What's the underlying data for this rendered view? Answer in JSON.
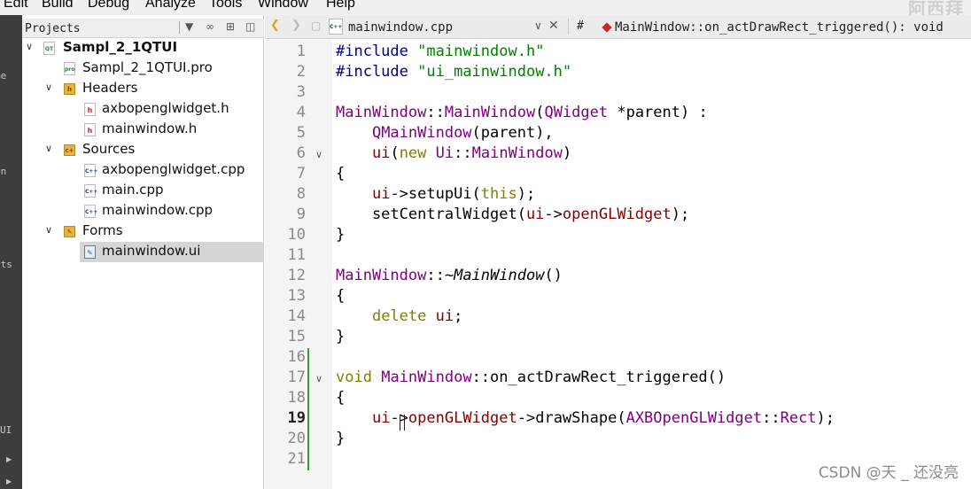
{
  "menu": [
    "Edit",
    "Build",
    "Debug",
    "Analyze",
    "Tools",
    "Window",
    "Help"
  ],
  "top_watermark": "阿西拜",
  "mode_bar": [
    "me",
    "t",
    "gn",
    "g",
    "cts",
    "p",
    "UI"
  ],
  "projects_panel": {
    "title": "Projects",
    "tree": [
      {
        "label": "Sampl_2_1QTUI",
        "icon": "project-icon",
        "expanded": true,
        "bold": true
      },
      {
        "label": "Sampl_2_1QTUI.pro",
        "icon": "pro-file-icon"
      },
      {
        "label": "Headers",
        "icon": "folder-icon",
        "expanded": true
      },
      {
        "label": "axbopenglwidget.h",
        "icon": "header-file-icon"
      },
      {
        "label": "mainwindow.h",
        "icon": "header-file-icon"
      },
      {
        "label": "Sources",
        "icon": "folder-icon",
        "expanded": true
      },
      {
        "label": "axbopenglwidget.cpp",
        "icon": "cpp-file-icon"
      },
      {
        "label": "main.cpp",
        "icon": "cpp-file-icon"
      },
      {
        "label": "mainwindow.cpp",
        "icon": "cpp-file-icon"
      },
      {
        "label": "Forms",
        "icon": "folder-icon",
        "expanded": true
      },
      {
        "label": "mainwindow.ui",
        "icon": "ui-file-icon",
        "selected": true
      }
    ]
  },
  "editor": {
    "open_file": "mainwindow.cpp",
    "hash": "#",
    "current_symbol": "MainWindow::on_actDrawRect_triggered(): void",
    "current_line": 19,
    "line_numbers": [
      "1",
      "2",
      "3",
      "4",
      "5",
      "6",
      "7",
      "8",
      "9",
      "10",
      "11",
      "12",
      "13",
      "14",
      "15",
      "16",
      "17",
      "18",
      "19",
      "20",
      "21"
    ],
    "lines": [
      "#include \"mainwindow.h\"",
      "#include \"ui_mainwindow.h\"",
      "",
      "MainWindow::MainWindow(QWidget *parent) :",
      "    QMainWindow(parent),",
      "    ui(new Ui::MainWindow)",
      "{",
      "    ui->setupUi(this);",
      "    setCentralWidget(ui->openGLWidget);",
      "}",
      "",
      "MainWindow::~MainWindow()",
      "{",
      "    delete ui;",
      "}",
      "",
      "void MainWindow::on_actDrawRect_triggered()",
      "{",
      "    ui->openGLWidget->drawShape(AXBOpenGLWidget::Rect);",
      "}",
      ""
    ]
  },
  "watermark": "CSDN @天 _ 还没亮"
}
